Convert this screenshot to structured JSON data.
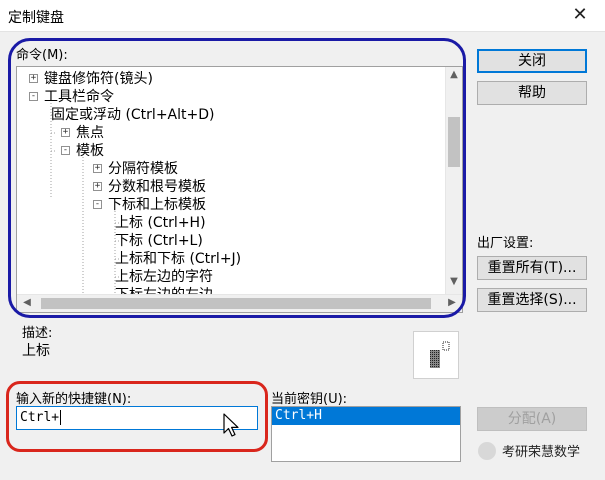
{
  "window": {
    "title": "定制键盘",
    "close_glyph": "✕"
  },
  "commands_label": "命令(M):",
  "tree": [
    {
      "label": "键盘修饰符(镜头)",
      "level": 0,
      "toggle": "+"
    },
    {
      "label": "工具栏命令",
      "level": 0,
      "toggle": "−"
    },
    {
      "label": "固定或浮动 (Ctrl+Alt+D)",
      "level": 1,
      "toggle": ""
    },
    {
      "label": "焦点",
      "level": 1,
      "toggle": "+"
    },
    {
      "label": "模板",
      "level": 1,
      "toggle": "−"
    },
    {
      "label": "分隔符模板",
      "level": 2,
      "toggle": "+"
    },
    {
      "label": "分数和根号模板",
      "level": 2,
      "toggle": "+"
    },
    {
      "label": "下标和上标模板",
      "level": 2,
      "toggle": "−"
    },
    {
      "label": "上标 (Ctrl+H)",
      "level": 3,
      "toggle": ""
    },
    {
      "label": "下标 (Ctrl+L)",
      "level": 3,
      "toggle": ""
    },
    {
      "label": "上标和下标 (Ctrl+J)",
      "level": 3,
      "toggle": ""
    },
    {
      "label": "上标左边的字符",
      "level": 3,
      "toggle": ""
    },
    {
      "label": "下标左边的左边",
      "level": 3,
      "toggle": ""
    }
  ],
  "buttons": {
    "close": "关闭",
    "help": "帮助",
    "reset_all": "重置所有(T)...",
    "reset_selection": "重置选择(S)...",
    "assign": "分配(A)"
  },
  "factory_label": "出厂设置:",
  "description": {
    "label": "描述:",
    "value": "上标"
  },
  "new_shortcut": {
    "label": "输入新的快捷键(N):",
    "value": "Ctrl+"
  },
  "current_keys": {
    "label": "当前密钥(U):",
    "items": [
      "Ctrl+H"
    ]
  },
  "watermark": "考研荣慧数学",
  "annotations": {
    "blue": "#1a1aa6",
    "red": "#d9261c"
  }
}
